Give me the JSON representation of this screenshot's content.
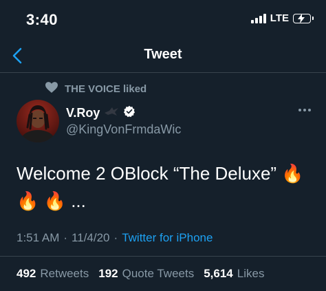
{
  "status_bar": {
    "time": "3:40",
    "network": "LTE"
  },
  "nav": {
    "title": "Tweet"
  },
  "social_context": {
    "text": "THE VOICE liked"
  },
  "author": {
    "display_name": "V.Roy",
    "handle": "@KingVonFrmdaWic"
  },
  "tweet": {
    "text": "Welcome 2 OBlock “The Deluxe” 🔥\n🔥 🔥 ...",
    "time": "1:51 AM",
    "separator": "·",
    "date": "11/4/20",
    "separator2": "·",
    "source": "Twitter for iPhone"
  },
  "stats": {
    "retweets_count": "492",
    "retweets_label": "Retweets",
    "quotes_count": "192",
    "quotes_label": "Quote Tweets",
    "likes_count": "5,614",
    "likes_label": "Likes"
  },
  "colors": {
    "background": "#15202b",
    "accent": "#1da1f2",
    "secondary_text": "#8899a6",
    "divider": "#38444d"
  },
  "icons": {
    "back": "chevron-left-icon",
    "heart": "heart-icon",
    "verified": "verified-badge-icon",
    "more": "more-horizontal-icon",
    "battery": "battery-charging-icon",
    "signal": "signal-bars-icon"
  }
}
